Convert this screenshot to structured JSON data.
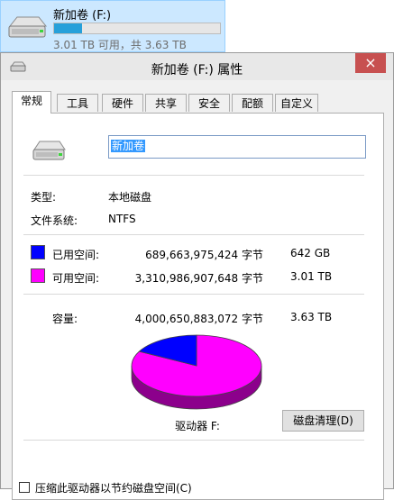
{
  "explorer_tile": {
    "drive_name": "新加卷 (F:)",
    "used_fraction": 0.17,
    "detail": "3.01 TB 可用，共 3.63 TB",
    "icon": "hard-drive-icon"
  },
  "dialog": {
    "title": "新加卷 (F:) 属性",
    "close_glyph": "×",
    "tabs": [
      "常规",
      "工具",
      "硬件",
      "共享",
      "安全",
      "配额",
      "自定义"
    ],
    "active_tab": "常规"
  },
  "general": {
    "volume_name": "新加卷",
    "type_label": "类型:",
    "type_value": "本地磁盘",
    "fs_label": "文件系统:",
    "fs_value": "NTFS",
    "used": {
      "label": "已用空间:",
      "bytes": "689,663,975,424 字节",
      "size": "642 GB",
      "color": "#0000ff"
    },
    "free": {
      "label": "可用空间:",
      "bytes": "3,310,986,907,648 字节",
      "size": "3.01 TB",
      "color": "#ff00ff"
    },
    "capacity": {
      "label": "容量:",
      "bytes": "4,000,650,883,072 字节",
      "size": "3.63 TB"
    },
    "drive_letter": "驱动器 F:",
    "cleanup_button": "磁盘清理(D)",
    "compress_label": "压缩此驱动器以节约磁盘空间(C)"
  },
  "colors": {
    "accent": "#26a0da",
    "tile_bg": "#cce8ff",
    "close": "#c75050"
  }
}
